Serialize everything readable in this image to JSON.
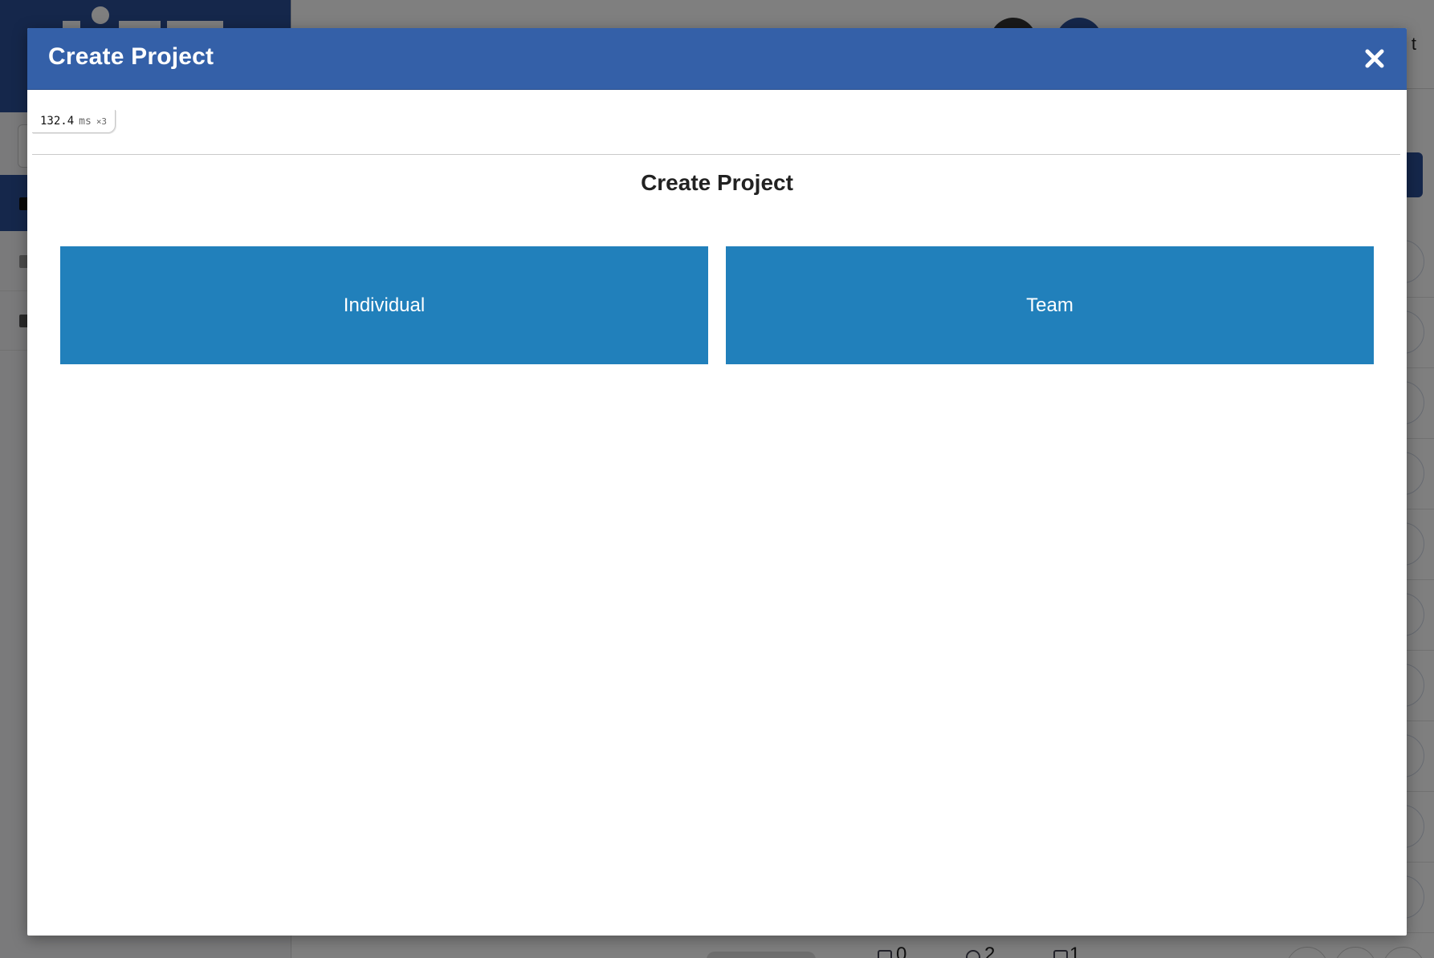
{
  "background": {
    "header_partial_text": "t",
    "footer_stats": [
      "0",
      "2",
      "1"
    ],
    "row_action_glyph": "✎"
  },
  "modal": {
    "title": "Create Project",
    "close_icon": "close-icon",
    "perf_badge": {
      "time": "132.4",
      "unit": "ms",
      "count": "×3"
    },
    "content_title": "Create Project",
    "options": [
      {
        "label": "Individual"
      },
      {
        "label": "Team"
      }
    ]
  },
  "colors": {
    "header": "#3460a8",
    "option_button": "#2180bb",
    "sidebar_brand": "#2b4f96"
  }
}
